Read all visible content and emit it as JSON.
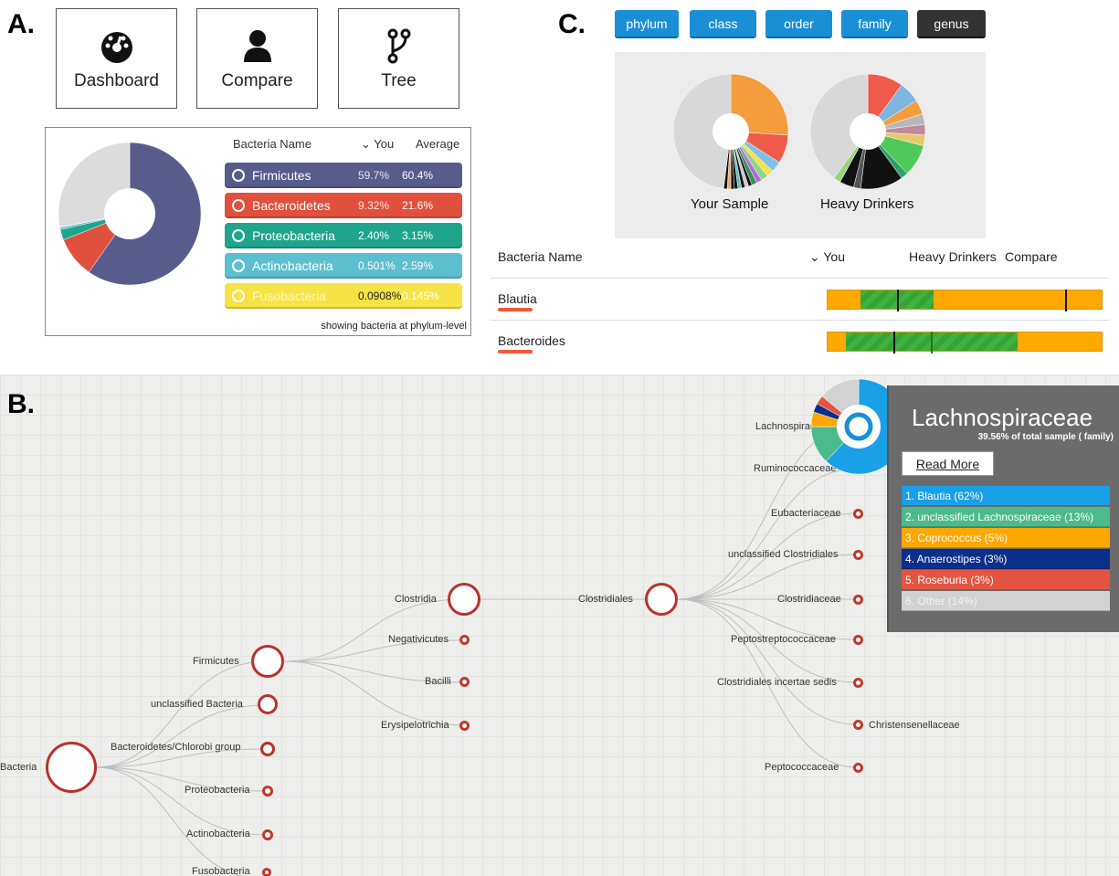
{
  "labels": {
    "a": "A.",
    "b": "B.",
    "c": "C."
  },
  "nav": [
    {
      "label": "Dashboard",
      "icon": "dashboard-icon"
    },
    {
      "label": "Compare",
      "icon": "user-icon"
    },
    {
      "label": "Tree",
      "icon": "branch-icon"
    }
  ],
  "phylum_table": {
    "header_name": "Bacteria Name",
    "header_you": "You",
    "header_avg": "Average",
    "rows": [
      {
        "name": "Firmicutes",
        "you": "59.7%",
        "avg": "60.4%",
        "color": "#585c8c",
        "you_value": 59.7
      },
      {
        "name": "Bacteroidetes",
        "you": "9.32%",
        "avg": "21.6%",
        "color": "#e0503c",
        "you_value": 9.32
      },
      {
        "name": "Proteobacteria",
        "you": "2.40%",
        "avg": "3.15%",
        "color": "#1fa58c",
        "you_value": 2.4
      },
      {
        "name": "Actinobacteria",
        "you": "0.501%",
        "avg": "2.59%",
        "color": "#5cbfd0",
        "you_value": 0.501
      },
      {
        "name": "Fusobacteria",
        "you": "0.0908%",
        "avg": "0.145%",
        "color": "#f7e345",
        "you_value": 0.0908
      }
    ],
    "footer": "showing bacteria at phylum-level"
  },
  "rank_buttons": [
    {
      "label": "phylum",
      "active": false
    },
    {
      "label": "class",
      "active": false
    },
    {
      "label": "order",
      "active": false
    },
    {
      "label": "family",
      "active": false
    },
    {
      "label": "genus",
      "active": true
    }
  ],
  "pies": {
    "left_label": "Your Sample",
    "right_label": "Heavy Drinkers"
  },
  "compare_table": {
    "header_name": "Bacteria Name",
    "header_you": "You",
    "header_group": "Heavy Drinkers",
    "header_compare": "Compare",
    "rows": [
      {
        "name": "Blautia"
      },
      {
        "name": "Bacteroides"
      }
    ]
  },
  "tree": {
    "root": "Bacteria",
    "phyla": [
      "Firmicutes",
      "unclassified Bacteria",
      "Bacteroidetes/Chlorobi group",
      "Proteobacteria",
      "Actinobacteria",
      "Fusobacteria"
    ],
    "classes": [
      "Clostridia",
      "Negativicutes",
      "Bacilli",
      "Erysipelotrichia"
    ],
    "order": "Clostridiales",
    "families": [
      "Lachnospiraceae",
      "Ruminococcaceae",
      "Eubacteriaceae",
      "unclassified Clostridiales",
      "Clostridiaceae",
      "Peptostreptococcaceae",
      "Clostridiales incertae sedis",
      "Christensenellaceae",
      "Peptococcaceae"
    ]
  },
  "info": {
    "title": "Lachnospiraceae",
    "subtitle": "39.56% of total sample ( family)",
    "read_more": "Read More",
    "items": [
      {
        "label": "1. Blautia (62%)",
        "color": "#1aa0e6"
      },
      {
        "label": "2. unclassified Lachnospiraceae (13%)",
        "color": "#4cba8c"
      },
      {
        "label": "3. Coprococcus (5%)",
        "color": "#ffa800"
      },
      {
        "label": "4. Anaerostipes (3%)",
        "color": "#0b2f8a"
      },
      {
        "label": "5. Roseburia (3%)",
        "color": "#e45440"
      },
      {
        "label": "6. Other (14%)",
        "color": "#d2d2d2"
      }
    ]
  }
}
